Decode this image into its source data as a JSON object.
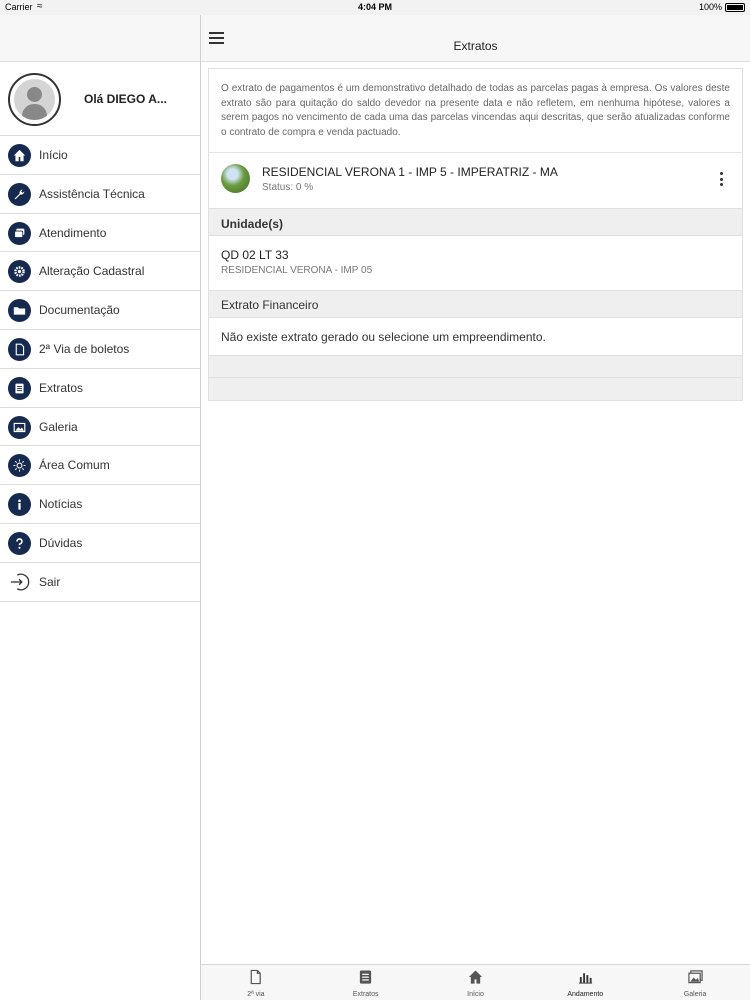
{
  "status_bar": {
    "carrier": "Carrier",
    "time": "4:04 PM",
    "battery": "100%"
  },
  "header": {
    "title": "Extratos"
  },
  "sidebar": {
    "greeting": "Olá DIEGO A...",
    "items": [
      {
        "label": "Início",
        "icon": "home-icon"
      },
      {
        "label": "Assistência Técnica",
        "icon": "wrench-icon"
      },
      {
        "label": "Atendimento",
        "icon": "chat-icon"
      },
      {
        "label": "Alteração Cadastral",
        "icon": "gear-icon"
      },
      {
        "label": "Documentação",
        "icon": "folder-icon"
      },
      {
        "label": "2ª Via de boletos",
        "icon": "document-icon"
      },
      {
        "label": "Extratos",
        "icon": "list-icon"
      },
      {
        "label": "Galeria",
        "icon": "gallery-icon"
      },
      {
        "label": "Área Comum",
        "icon": "sun-icon"
      },
      {
        "label": "Notícias",
        "icon": "info-icon"
      },
      {
        "label": "Dúvidas",
        "icon": "question-icon"
      },
      {
        "label": "Sair",
        "icon": "logout-icon"
      }
    ]
  },
  "main": {
    "info_text": "O extrato de pagamentos é um demonstrativo detalhado de todas as parcelas pagas à empresa. Os valores deste extrato são para quitação do saldo devedor na presente data e não refletem, em nenhuma hipótese, valores a serem pagos no vencimento de cada uma das parcelas vincendas aqui descritas, que serão atualizadas conforme o contrato de compra e venda pactuado.",
    "enterprise": {
      "title": "RESIDENCIAL VERONA 1 - IMP 5 - IMPERATRIZ - MA",
      "status": "Status: 0 %"
    },
    "units_header": "Unidade(s)",
    "unit": {
      "title": "QD 02 LT 33",
      "subtitle": "RESIDENCIAL VERONA - IMP 05"
    },
    "extrato_header": "Extrato Financeiro",
    "empty_message": "Não existe extrato gerado ou selecione um empreendimento."
  },
  "tabbar": {
    "tabs": [
      {
        "label": "2ª via",
        "icon": "document-icon"
      },
      {
        "label": "Extratos",
        "icon": "list-icon"
      },
      {
        "label": "Início",
        "icon": "home-icon"
      },
      {
        "label": "Andamento",
        "icon": "bar-chart-icon",
        "active": true
      },
      {
        "label": "Galeria",
        "icon": "gallery-icon"
      }
    ]
  },
  "colors": {
    "menu_icon_bg": "#16294f",
    "section_bg": "#efefef"
  }
}
